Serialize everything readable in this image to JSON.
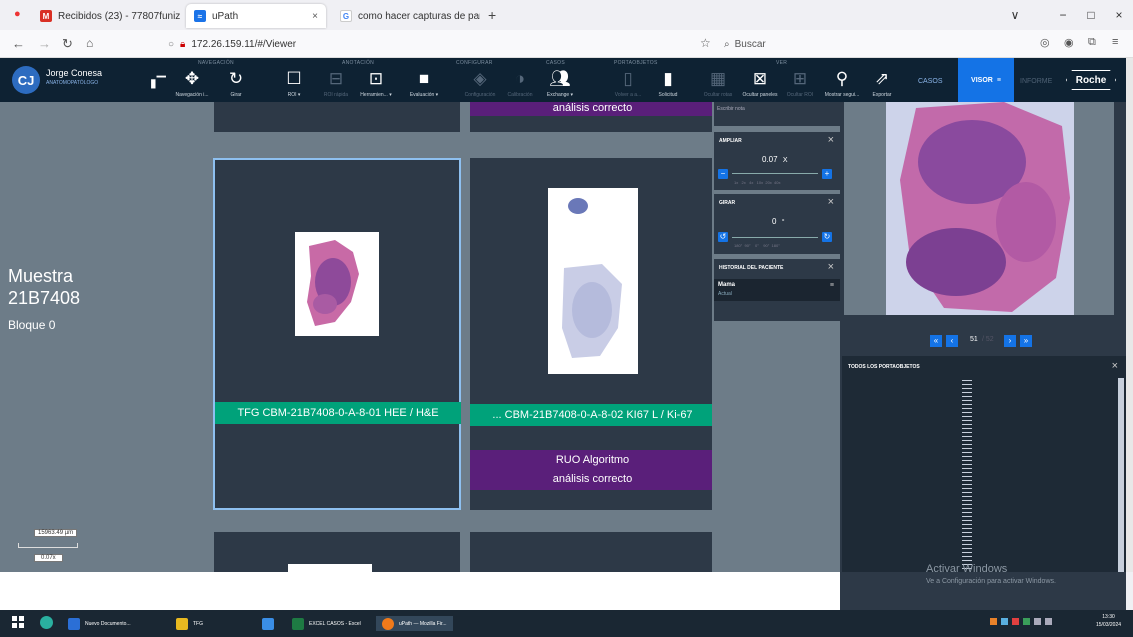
{
  "browser": {
    "tabs": [
      {
        "label": "Recibidos (23) - 77807funiza@ ×",
        "icon_color": "#d93025"
      },
      {
        "label": "uPath",
        "icon_color": "#1a73e8"
      },
      {
        "label": "como hacer capturas de pantall ×",
        "icon_color": "#ea4335"
      }
    ],
    "new_tab": "+",
    "url": "172.26.159.11/#/Viewer",
    "search_placeholder": "Buscar",
    "controls": {
      "minimize": "−",
      "maximize": "□",
      "close": "×",
      "list": "∨"
    }
  },
  "user": {
    "initials": "CJ",
    "name": "Jorge Conesa",
    "role": "ANATOMOPATÓLOGO"
  },
  "toolbar": {
    "groups": {
      "navegacion": "NAVEGACIÓN",
      "anotacion": "ANOTACIÓN",
      "configurar": "CONFIGURAR",
      "casos": "CASOS",
      "portaobjetos": "PORTAOBJETOS",
      "ver": "VER"
    },
    "buttons": {
      "navegacion": "Navegación i...",
      "girar": "Girar",
      "roi": "ROI ▾",
      "roi_rapida": "ROI rápida",
      "herramientas": "Herramien... ▾",
      "evaluacion": "Evaluación ▾",
      "configuracion": "Configuración",
      "calibracion": "Calibración",
      "exchange": "Exchange ▾",
      "volver": "Volver a a...",
      "solicitud": "Solicitud",
      "ocultar_rotas": "Ocultar rotas",
      "ocultar_paneles": "Ocultar paneles",
      "ocultar_roi": "Ocultar ROI",
      "mostrar_segui": "Mostrar segui...",
      "exportar": "Exportar"
    },
    "nav": {
      "casos": "CASOS",
      "visor": "VISOR",
      "informe": "INFORME"
    },
    "logo": "Roche"
  },
  "specimen": {
    "title_line1": "Muestra",
    "title_line2": "21B7408",
    "block": "Bloque 0"
  },
  "scale": {
    "length": "15963.49 µm",
    "zoom": "0.07x"
  },
  "slides": {
    "top_partial_label": "análisis correcto",
    "card1_label": "TFG CBM-21B7408-0-A-8-01 HEE / H&E",
    "card2_label": "... CBM-21B7408-0-A-8-02 KI67 L / Ki-67",
    "card2_ruo_line1": "RUO Algoritmo",
    "card2_ruo_line2": "análisis correcto"
  },
  "controls": {
    "note_placeholder": "Escribir nota",
    "ampliar": {
      "title": "AMPLIAR",
      "value": "0.07",
      "unit": "X",
      "ticks": "1x   2x   4x   10x  20x  40x"
    },
    "girar": {
      "title": "GIRAR",
      "value": "0",
      "unit": "°",
      "ticks": "180°  90°    0°    90°  180°"
    },
    "historial": {
      "title": "HISTORIAL DEL PACIENTE",
      "item": "Mama",
      "subitem": "Actual"
    }
  },
  "preview": {
    "page_current": "51",
    "page_total": "/ 52"
  },
  "all_slides": {
    "title": "TODOS LOS PORTAOBJETOS"
  },
  "watermark": {
    "line1": "Activar Windows",
    "line2": "Ve a Configuración para activar Windows."
  },
  "taskbar": {
    "items": [
      "Nuevo Documento...",
      "TFG",
      "",
      "EXCEL CASOS - Excel",
      "uPath — Mozilla Fir..."
    ],
    "time": "13:30",
    "date": "15/03/2024"
  }
}
